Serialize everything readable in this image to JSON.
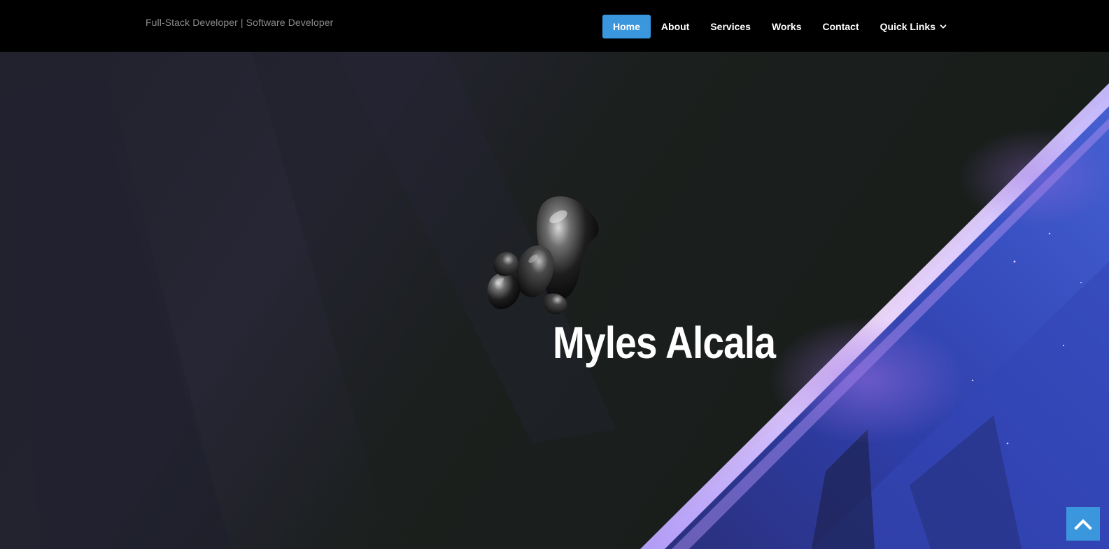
{
  "header": {
    "tagline": "Full-Stack Developer | Software Developer",
    "nav": {
      "home": "Home",
      "about": "About",
      "services": "Services",
      "works": "Works",
      "contact": "Contact",
      "quick_links": "Quick Links"
    },
    "active_item": "Home",
    "dropdown_icon": "chevron-down-icon"
  },
  "hero": {
    "title": "Myles Alcala",
    "art_icon": "abstract-blob-art"
  },
  "back_to_top": {
    "icon": "chevron-up-icon"
  },
  "colors": {
    "accent": "#3b97dd",
    "header_bg": "#000000",
    "text": "#ffffff",
    "tagline": "#8c8c8c"
  }
}
